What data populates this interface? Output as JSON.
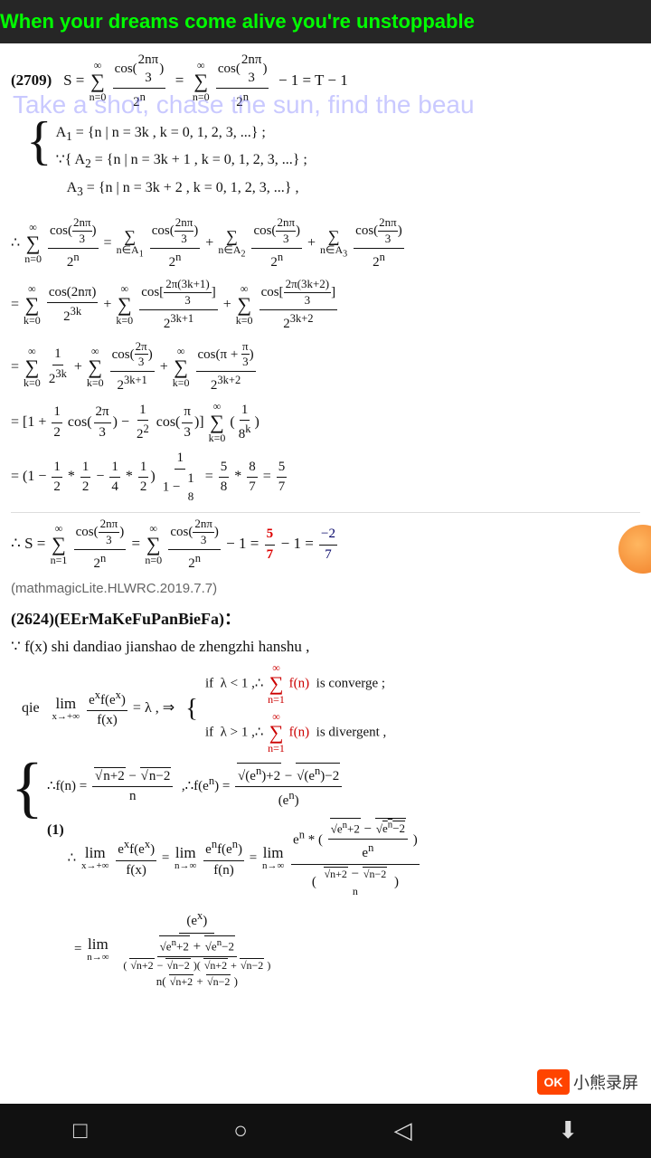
{
  "marquee": {
    "text": "When your dreams come alive you're unstoppable"
  },
  "overlay": {
    "text": "Take a shot, chase the sun, find the beau"
  },
  "content": {
    "problem_2709": "(2709)",
    "attribution": "(mathmagicLite.HLWRC.2019.7.7)",
    "problem_2624_label": "(2624)(EErMaKeFuPanBieFa)：",
    "problem_2624_line1": "∵ f(x) shi dandiao jianshao de zhengzhi hanshu ,",
    "problem_2624_line2": "qie lim f(eˣ)·f(eˣ)/f(x) = λ"
  },
  "nav": {
    "square": "□",
    "circle": "○",
    "triangle": "◁",
    "down": "⬇"
  },
  "watermark": {
    "text": "小熊录屏",
    "icon": "OK"
  },
  "colors": {
    "background": "#ffffff",
    "text": "#111111",
    "red": "#cc0000",
    "green": "#00cc00",
    "marquee_bg": "#000000",
    "marquee_text": "#00ff00",
    "nav_bg": "#111111",
    "orange": "#ee6600"
  }
}
